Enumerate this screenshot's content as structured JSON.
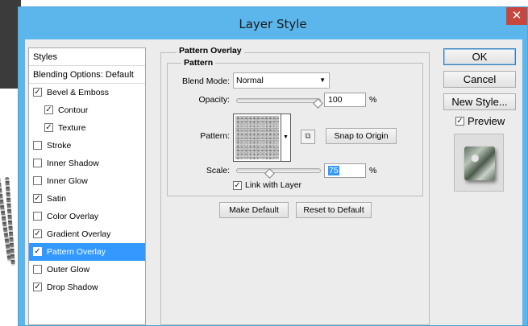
{
  "window": {
    "title": "Layer Style",
    "close_glyph": "✕"
  },
  "styles_panel": {
    "header": "Styles",
    "blending": "Blending Options: Default",
    "items": [
      {
        "label": "Bevel & Emboss",
        "checked": true,
        "indent": 0
      },
      {
        "label": "Contour",
        "checked": true,
        "indent": 1
      },
      {
        "label": "Texture",
        "checked": true,
        "indent": 1
      },
      {
        "label": "Stroke",
        "checked": false,
        "indent": 0
      },
      {
        "label": "Inner Shadow",
        "checked": false,
        "indent": 0
      },
      {
        "label": "Inner Glow",
        "checked": false,
        "indent": 0
      },
      {
        "label": "Satin",
        "checked": true,
        "indent": 0
      },
      {
        "label": "Color Overlay",
        "checked": false,
        "indent": 0
      },
      {
        "label": "Gradient Overlay",
        "checked": true,
        "indent": 0
      },
      {
        "label": "Pattern Overlay",
        "checked": true,
        "indent": 0,
        "selected": true
      },
      {
        "label": "Outer Glow",
        "checked": false,
        "indent": 0
      },
      {
        "label": "Drop Shadow",
        "checked": true,
        "indent": 0
      }
    ]
  },
  "pattern_overlay": {
    "section_title": "Pattern Overlay",
    "group_title": "Pattern",
    "blend_mode_label": "Blend Mode:",
    "blend_mode_value": "Normal",
    "opacity_label": "Opacity:",
    "opacity_value": "100",
    "opacity_level": 1.0,
    "percent": "%",
    "pattern_label": "Pattern:",
    "snap_button": "Snap to Origin",
    "scale_label": "Scale:",
    "scale_value": "75",
    "scale_level": 0.37,
    "link_label": "Link with Layer",
    "link_checked": true,
    "make_default": "Make Default",
    "reset_default": "Reset to Default"
  },
  "right_panel": {
    "ok": "OK",
    "cancel": "Cancel",
    "new_style": "New Style...",
    "preview_label": "Preview",
    "preview_checked": true
  },
  "icons": {
    "close": "close-icon",
    "dropdown": "chevron-down-icon",
    "new_preset": "new-preset-icon",
    "checkmark": "checkmark-icon"
  },
  "colors": {
    "titlebar": "#5bb6ec",
    "selection": "#3399ff",
    "close": "#c7463d",
    "highlight_text": "#3399ff"
  }
}
